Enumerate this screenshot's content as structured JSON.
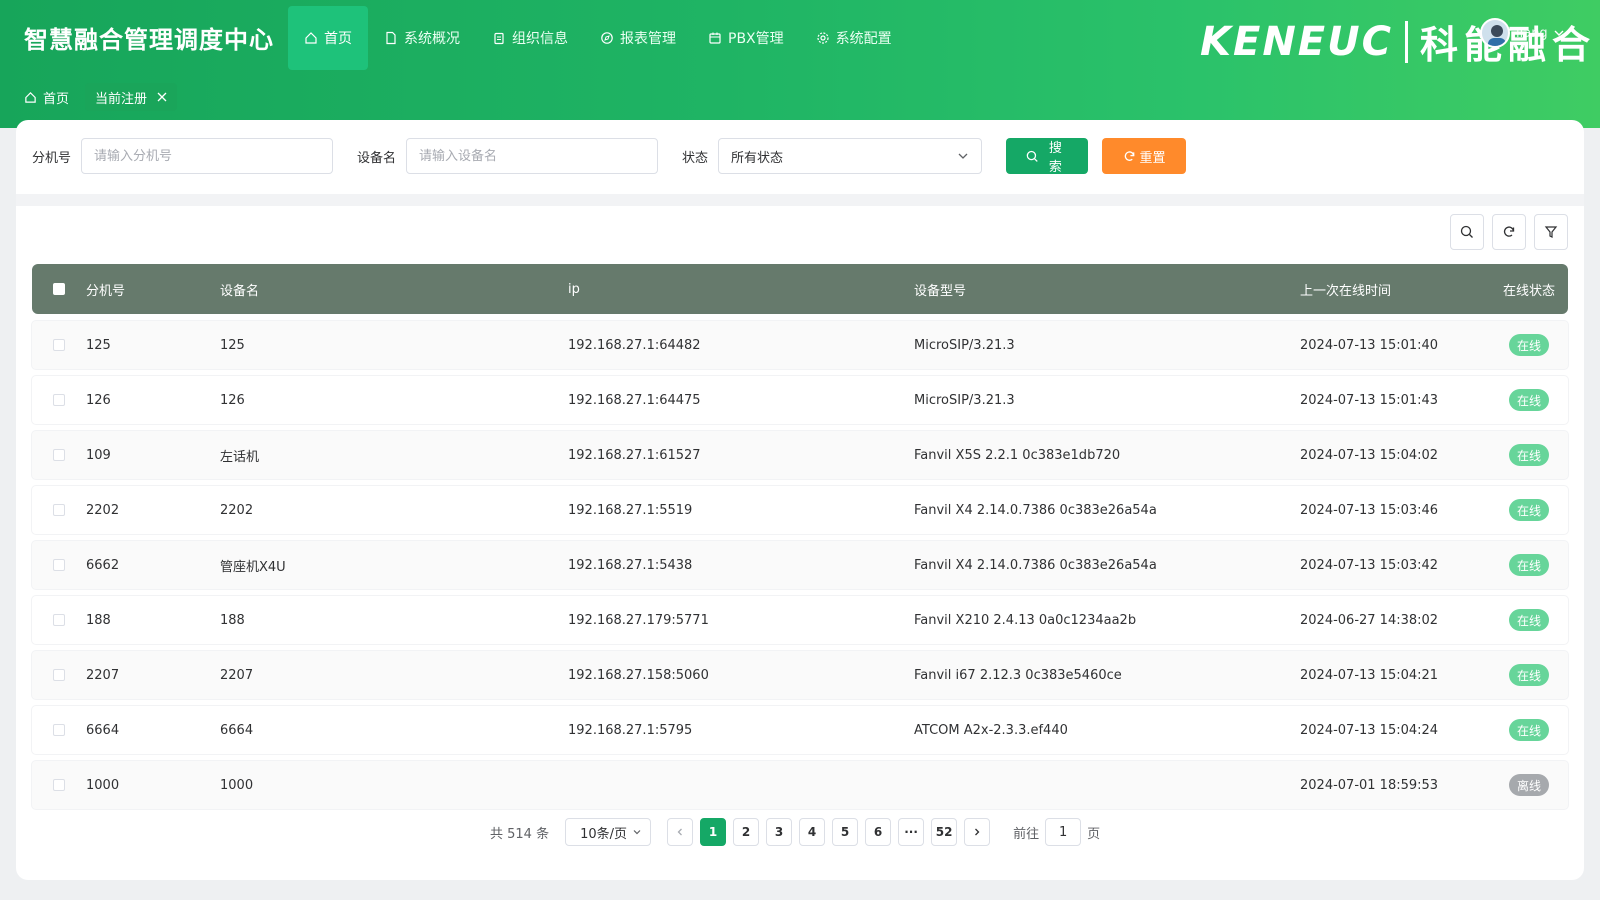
{
  "header": {
    "app_title": "智慧融合管理调度中心",
    "nav": [
      {
        "label": "首页",
        "icon": "home-icon",
        "active": true
      },
      {
        "label": "系统概况",
        "icon": "document-icon",
        "active": false
      },
      {
        "label": "组织信息",
        "icon": "clipboard-icon",
        "active": false
      },
      {
        "label": "报表管理",
        "icon": "compass-icon",
        "active": false
      },
      {
        "label": "PBX管理",
        "icon": "calendar-icon",
        "active": false
      },
      {
        "label": "系统配置",
        "icon": "gear-icon",
        "active": false
      }
    ],
    "brand_latin": "KENEUC",
    "brand_cjk": "科能融合",
    "user_name": "liang"
  },
  "tabs": {
    "home_label": "首页",
    "current_label": "当前注册"
  },
  "filters": {
    "ext_label": "分机号",
    "ext_placeholder": "请输入分机号",
    "dev_label": "设备名",
    "dev_placeholder": "请输入设备名",
    "status_label": "状态",
    "status_value": "所有状态",
    "search_label": "搜索",
    "reset_label": "重置"
  },
  "table": {
    "columns": [
      "分机号",
      "设备名",
      "ip",
      "设备型号",
      "上一次在线时间",
      "在线状态"
    ],
    "rows": [
      {
        "ext": "125",
        "dev": "125",
        "ip": "192.168.27.1:64482",
        "model": "MicroSIP/3.21.3",
        "time": "2024-07-13 15:01:40",
        "status": "在线",
        "online": true
      },
      {
        "ext": "126",
        "dev": "126",
        "ip": "192.168.27.1:64475",
        "model": "MicroSIP/3.21.3",
        "time": "2024-07-13 15:01:43",
        "status": "在线",
        "online": true
      },
      {
        "ext": "109",
        "dev": "左话机",
        "ip": "192.168.27.1:61527",
        "model": "Fanvil X5S 2.2.1 0c383e1db720",
        "time": "2024-07-13 15:04:02",
        "status": "在线",
        "online": true
      },
      {
        "ext": "2202",
        "dev": "2202",
        "ip": "192.168.27.1:5519",
        "model": "Fanvil X4 2.14.0.7386 0c383e26a54a",
        "time": "2024-07-13 15:03:46",
        "status": "在线",
        "online": true
      },
      {
        "ext": "6662",
        "dev": "管座机X4U",
        "ip": "192.168.27.1:5438",
        "model": "Fanvil X4 2.14.0.7386 0c383e26a54a",
        "time": "2024-07-13 15:03:42",
        "status": "在线",
        "online": true
      },
      {
        "ext": "188",
        "dev": "188",
        "ip": "192.168.27.179:5771",
        "model": "Fanvil X210 2.4.13 0a0c1234aa2b",
        "time": "2024-06-27 14:38:02",
        "status": "在线",
        "online": true
      },
      {
        "ext": "2207",
        "dev": "2207",
        "ip": "192.168.27.158:5060",
        "model": "Fanvil i67 2.12.3 0c383e5460ce",
        "time": "2024-07-13 15:04:21",
        "status": "在线",
        "online": true
      },
      {
        "ext": "6664",
        "dev": "6664",
        "ip": "192.168.27.1:5795",
        "model": "ATCOM A2x-2.3.3.ef440",
        "time": "2024-07-13 15:04:24",
        "status": "在线",
        "online": true
      },
      {
        "ext": "1000",
        "dev": "1000",
        "ip": "",
        "model": "",
        "time": "2024-07-01 18:59:53",
        "status": "离线",
        "online": false
      }
    ]
  },
  "pagination": {
    "total_label": "共 514 条",
    "page_size": "10条/页",
    "pages": [
      "1",
      "2",
      "3",
      "4",
      "5",
      "6",
      "···",
      "52"
    ],
    "current_page": "1",
    "goto_prefix": "前往",
    "goto_value": "1",
    "goto_suffix": "页"
  },
  "colors": {
    "primary": "#15a866",
    "reset": "#ff8a2b",
    "table_header": "#667a6c",
    "online_badge": "#67d59a",
    "offline_badge": "#a6a9ad"
  }
}
